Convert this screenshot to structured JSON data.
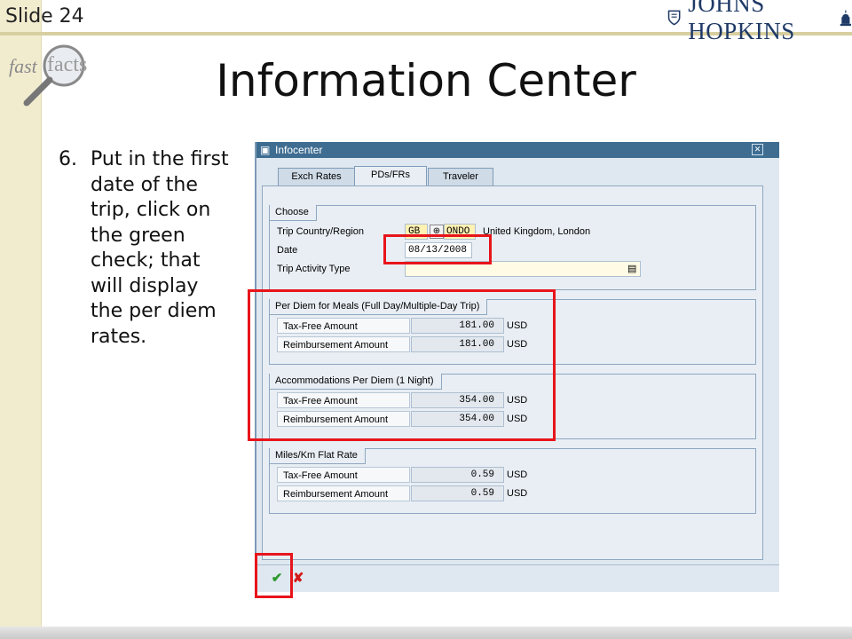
{
  "slide": {
    "number_label": "Slide 24",
    "title": "Information Center",
    "logo_text": "JOHNS HOPKINS",
    "fastfacts": {
      "word1": "fast",
      "word2": "facts"
    }
  },
  "instruction": {
    "number": "6.",
    "text": "Put in the first date of the trip, click on the green check; that will display the per diem rates."
  },
  "sap": {
    "window_title": "Infocenter",
    "tabs": [
      {
        "label": "Exch Rates"
      },
      {
        "label": "PDs/FRs"
      },
      {
        "label": "Traveler"
      }
    ],
    "choose": {
      "header": "Choose",
      "country_label": "Trip Country/Region",
      "country_code": "GB",
      "region_code": "ONDO",
      "country_name": "United Kingdom, London",
      "date_label": "Date",
      "date_value": "08/13/2008",
      "activity_label": "Trip Activity Type",
      "activity_value": ""
    },
    "meals": {
      "header": "Per Diem for Meals (Full Day/Multiple-Day Trip)",
      "rows": [
        {
          "label": "Tax-Free Amount",
          "value": "181.00",
          "unit": "USD"
        },
        {
          "label": "Reimbursement Amount",
          "value": "181.00",
          "unit": "USD"
        }
      ]
    },
    "accommodations": {
      "header": "Accommodations Per Diem (1 Night)",
      "rows": [
        {
          "label": "Tax-Free Amount",
          "value": "354.00",
          "unit": "USD"
        },
        {
          "label": "Reimbursement Amount",
          "value": "354.00",
          "unit": "USD"
        }
      ]
    },
    "miles": {
      "header": "Miles/Km Flat Rate",
      "rows": [
        {
          "label": "Tax-Free Amount",
          "value": "0.59",
          "unit": "USD"
        },
        {
          "label": "Reimbursement Amount",
          "value": "0.59",
          "unit": "USD"
        }
      ]
    },
    "footer": {
      "confirm_icon": "green-check-icon",
      "cancel_icon": "red-x-icon"
    }
  },
  "colors": {
    "callout": "#e8141b",
    "title_bar": "#3f6d92",
    "panel": "#e8eef4",
    "slide_band": "#f2eccf"
  }
}
